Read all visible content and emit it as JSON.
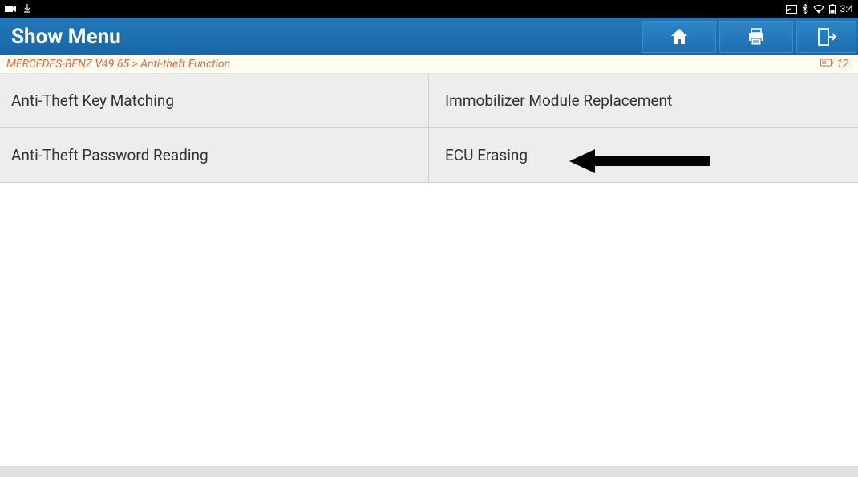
{
  "status_bar": {
    "time": "3:4"
  },
  "header": {
    "title": "Show Menu"
  },
  "breadcrumb": {
    "path": "MERCEDES-BENZ V49.65 > Anti-theft Function",
    "right_value": "12."
  },
  "menu": {
    "items": [
      {
        "label": "Anti-Theft Key Matching"
      },
      {
        "label": "Immobilizer Module Replacement"
      },
      {
        "label": "Anti-Theft Password Reading"
      },
      {
        "label": "ECU Erasing"
      }
    ]
  }
}
